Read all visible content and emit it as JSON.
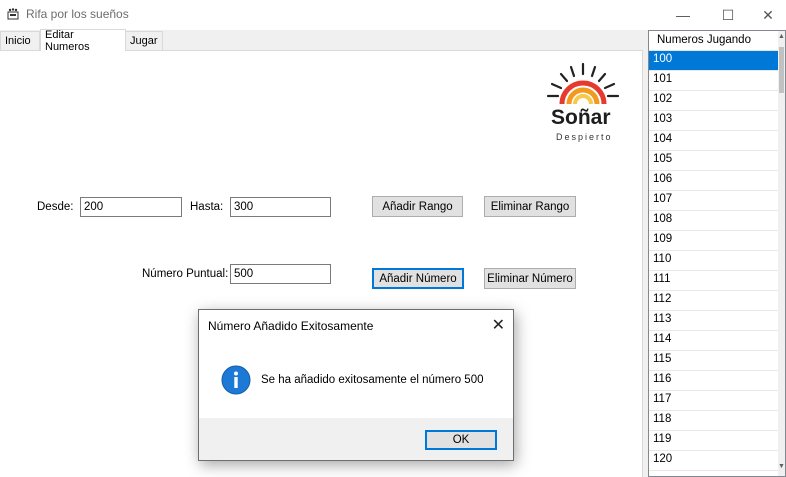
{
  "window": {
    "title": "Rifa por los sueños",
    "minimize_glyph": "—",
    "maximize_glyph": "☐",
    "close_glyph": "✕"
  },
  "tabs": [
    {
      "label": "Inicio"
    },
    {
      "label": "Editar Numeros"
    },
    {
      "label": "Jugar"
    }
  ],
  "logo": {
    "word": "Soñar",
    "sub": "Despierto"
  },
  "range": {
    "desde_label": "Desde:",
    "desde_value": "200",
    "hasta_label": "Hasta:",
    "hasta_value": "300",
    "add_label": "Añadir Rango",
    "remove_label": "Eliminar Rango"
  },
  "single": {
    "label": "Número Puntual:",
    "value": "500",
    "add_label": "Añadir Número",
    "remove_label": "Eliminar Número"
  },
  "list": {
    "header": "Numeros Jugando",
    "items": [
      "100",
      "101",
      "102",
      "103",
      "104",
      "105",
      "106",
      "107",
      "108",
      "109",
      "110",
      "111",
      "112",
      "113",
      "114",
      "115",
      "116",
      "117",
      "118",
      "119",
      "120"
    ],
    "selected_index": 0
  },
  "dialog": {
    "title": "Número Añadido Exitosamente",
    "message": "Se ha añadido exitosamente el número 500",
    "ok_label": "OK",
    "close_glyph": "✕"
  },
  "colors": {
    "accent": "#0078d7",
    "info_icon": "#1c79d6"
  }
}
